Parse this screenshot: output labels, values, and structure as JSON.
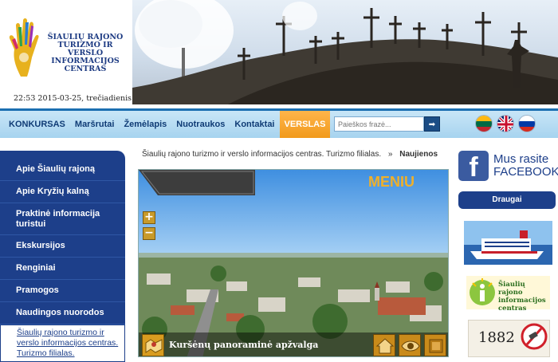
{
  "logo": {
    "text_line1": "Šiaulių rajono",
    "text_line2": "turizmo ir verslo",
    "text_line3": "informacijos",
    "text_line4": "centras"
  },
  "header": {
    "datetime": "22:53 2015-03-25, trečiadienis"
  },
  "nav": {
    "items": [
      {
        "label": "KONKURSAS"
      },
      {
        "label": "Maršrutai"
      },
      {
        "label": "Žemėlapis"
      },
      {
        "label": "Nuotraukos"
      },
      {
        "label": "Kontaktai"
      },
      {
        "label": "VERSLAS"
      }
    ],
    "search_placeholder": "Paieškos frazė...",
    "search_button": "➡",
    "flags": [
      "lt-flag",
      "uk-flag",
      "ru-flag"
    ]
  },
  "sidebar": {
    "items": [
      {
        "label": "Apie Šiaulių rajoną"
      },
      {
        "label": "Apie Kryžių kalną"
      },
      {
        "label": "Praktinė informacija turistui"
      },
      {
        "label": "Ekskursijos"
      },
      {
        "label": "Renginiai"
      },
      {
        "label": "Pramogos"
      },
      {
        "label": "Naudingos nuorodos"
      },
      {
        "label": "Šiaulių rajono turizmo ir verslo informacijos centras. Turizmo filialas."
      }
    ]
  },
  "main": {
    "breadcrumb": {
      "parent": "Šiaulių rajono turizmo ir verslo informacijos centras. Turizmo filialas.",
      "separator": "»",
      "current": "Naujienos"
    },
    "panorama": {
      "menu_label": "MENIU",
      "zoom_in": "+",
      "zoom_out": "−",
      "caption": "Kuršėnų panoraminė apžvalga"
    }
  },
  "right": {
    "facebook_line1": "Mus rasite",
    "facebook_line2": "FACEBOOK",
    "facebook_letter": "f",
    "draugai": "Draugai",
    "tic_line1": "Šiaulių rajono",
    "tic_line2": "informacijos",
    "tic_line3": "centras",
    "phone": "1882"
  },
  "colors": {
    "brand_blue": "#1d3f8a",
    "nav_active": "#f19a1c",
    "nav_bg": "#a6d3ef"
  }
}
